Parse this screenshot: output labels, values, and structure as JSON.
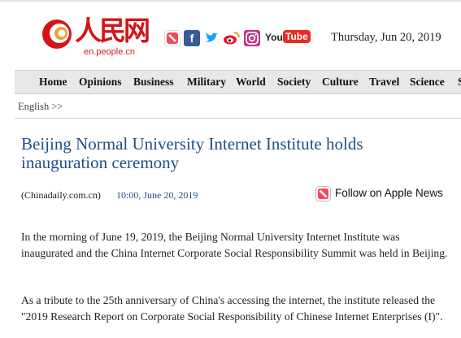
{
  "brand": {
    "name_cn": "人民网",
    "domain": "en.people.cn",
    "colors": {
      "red": "#d21618",
      "title_blue": "#1e4f86"
    }
  },
  "social_icons": [
    "apple-news-icon",
    "facebook-icon",
    "twitter-icon",
    "weibo-icon",
    "instagram-icon",
    "youtube-icon"
  ],
  "youtube_label": "YouTube",
  "date": "Thursday, Jun 20, 2019",
  "nav": [
    "Home",
    "Opinions",
    "Business",
    "Military",
    "World",
    "Society",
    "Culture",
    "Travel",
    "Science",
    "S"
  ],
  "breadcrumb": "English >>",
  "article": {
    "title": "Beijing Normal University Internet Institute holds inauguration ceremony",
    "source": "(Chinadaily.com.cn)",
    "time": "10:00, June 20, 2019",
    "follow_label": "Follow on Apple News",
    "paragraphs": [
      "In the morning of June 19, 2019, the Beijing Normal University Internet Institute was inaugurated and the China Internet Corporate Social Responsibility Summit was held in Beijing.",
      "As a tribute to the 25th anniversary of China's accessing the internet, the institute released the \"2019 Research Report on Corporate Social Responsibility of Chinese Internet Enterprises (I)\"."
    ]
  }
}
